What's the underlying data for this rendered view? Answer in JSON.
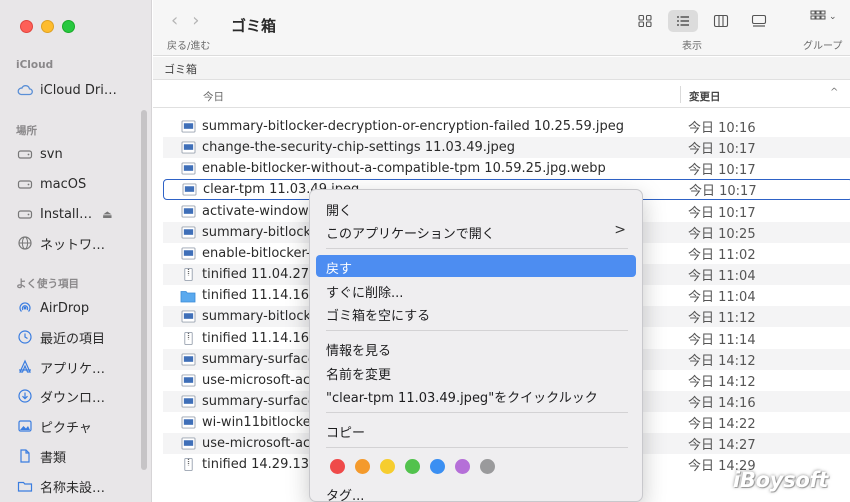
{
  "window": {
    "title": "ゴミ箱",
    "nav_label": "戻る/進む",
    "view_label": "表示",
    "group_label": "グループ"
  },
  "sidebar": {
    "sections": [
      {
        "label": "iCloud"
      },
      {
        "label": "場所"
      },
      {
        "label": "よく使う項目"
      }
    ],
    "items": [
      {
        "label": "iCloud Dri…",
        "icon": "cloud-icon"
      },
      {
        "label": "svn",
        "icon": "drive-icon"
      },
      {
        "label": "macOS",
        "icon": "drive-icon"
      },
      {
        "label": "Install…",
        "icon": "drive-icon"
      },
      {
        "label": "ネットワ…",
        "icon": "globe-icon"
      },
      {
        "label": "AirDrop",
        "icon": "airdrop-icon"
      },
      {
        "label": "最近の項目",
        "icon": "clock-icon"
      },
      {
        "label": "アプリケ…",
        "icon": "apps-icon"
      },
      {
        "label": "ダウンロ…",
        "icon": "download-icon"
      },
      {
        "label": "ピクチャ",
        "icon": "photo-icon"
      },
      {
        "label": "書類",
        "icon": "document-icon"
      },
      {
        "label": "名称未設…",
        "icon": "folder-icon"
      }
    ]
  },
  "pathbar": {
    "label": "ゴミ箱"
  },
  "header": {
    "today": "今日",
    "modified": "変更日",
    "sort_arrow": "^"
  },
  "files": [
    {
      "name": "summary-bitlocker-decryption-or-encryption-failed 10.25.59.jpeg",
      "date": "今日 10:16",
      "icon": "image-icon"
    },
    {
      "name": "change-the-security-chip-settings 11.03.49.jpeg",
      "date": "今日 10:17",
      "icon": "image-icon"
    },
    {
      "name": "enable-bitlocker-without-a-compatible-tpm 10.59.25.jpg.webp",
      "date": "今日 10:17",
      "icon": "image-icon"
    },
    {
      "name": "clear-tpm 11.03.49.jpeg",
      "date": "今日 10:17",
      "icon": "image-icon"
    },
    {
      "name": "activate-windows",
      "date": "今日 10:17",
      "icon": "image-icon"
    },
    {
      "name": "summary-bitlocker",
      "date": "今日 10:25",
      "icon": "image-icon"
    },
    {
      "name": "enable-bitlocker-",
      "date": "今日 11:02",
      "icon": "image-icon"
    },
    {
      "name": "tinified 11.04.27.z",
      "date": "今日 11:04",
      "icon": "zip-icon"
    },
    {
      "name": "tinified 11.14.16",
      "date": "今日 11:04",
      "icon": "folder-icon"
    },
    {
      "name": "summary-bitlocker",
      "date": "今日 11:12",
      "icon": "image-icon"
    },
    {
      "name": "tinified 11.14.16.z",
      "date": "今日 11:14",
      "icon": "zip-icon"
    },
    {
      "name": "summary-surface",
      "date": "今日 14:12",
      "icon": "image-icon"
    },
    {
      "name": "use-microsoft-ac",
      "date": "今日 14:12",
      "icon": "image-icon"
    },
    {
      "name": "summary-surface",
      "date": "今日 14:16",
      "icon": "image-icon"
    },
    {
      "name": "wi-win11bitlocker",
      "date": "今日 14:22",
      "icon": "image-icon"
    },
    {
      "name": "use-microsoft-ac",
      "date": "今日 14:27",
      "icon": "image-icon"
    },
    {
      "name": "tinified 14.29.13.z",
      "date": "今日 14:29",
      "icon": "zip-icon"
    }
  ],
  "context_menu": {
    "open": "開く",
    "open_with": "このアプリケーションで開く",
    "submenu_arrow": ">",
    "put_back": "戻す",
    "delete_immediately": "すぐに削除...",
    "empty_trash": "ゴミ箱を空にする",
    "get_info": "情報を見る",
    "rename": "名前を変更",
    "quick_look": "\"clear-tpm 11.03.49.jpeg\"をクイックルック",
    "copy": "コピー",
    "tags_label": "タグ...",
    "tag_colors": [
      "#ef4a4a",
      "#f49a2c",
      "#f6cd2f",
      "#52c24d",
      "#3b8ff2",
      "#b56fd8",
      "#9a9a9c"
    ]
  },
  "watermark": {
    "text": "iBoysoft"
  }
}
